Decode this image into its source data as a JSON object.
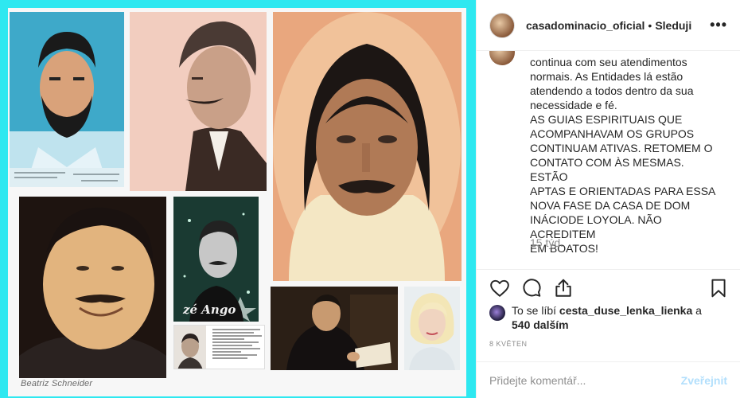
{
  "post": {
    "image_credit": "Beatriz Schneider",
    "image_caption": "zé Ango"
  },
  "header": {
    "username": "casadominacio_oficial",
    "separator": "•",
    "follow_label": "Sleduji",
    "more_label": "•••"
  },
  "comment": {
    "text": "continua com seu atendimentos\nnormais. As Entidades lá estão\natendendo a todos dentro da sua\nnecessidade e fé.\nAS GUIAS ESPIRITUAIS QUE\nACOMPANHAVAM OS GRUPOS\nCONTINUAM ATIVAS. RETOMEM O\nCONTATO COM ÀS MESMAS. ESTÃO\nAPTAS E ORIENTADAS PARA ESSA\nNOVA FASE DA CASA DE DOM\nINÁCIODE LOYOLA. NÃO ACREDITEM\nEM BOATOS!",
    "time": "15 týd."
  },
  "actions": {
    "like_icon": "heart-icon",
    "comment_icon": "comment-icon",
    "share_icon": "share-icon",
    "save_icon": "bookmark-icon"
  },
  "likes": {
    "prefix": "To se líbí",
    "user": "cesta_duse_lenka_lienka",
    "connector": "a",
    "count": "540 dalším"
  },
  "date": "8 KVĚTEN",
  "composer": {
    "placeholder": "Přidejte komentář...",
    "post_label": "Zveřejnit"
  },
  "colors": {
    "frame": "#2ee8f0",
    "text": "#262626",
    "muted": "#8e8e8e",
    "post_disabled": "#b2dffc"
  }
}
